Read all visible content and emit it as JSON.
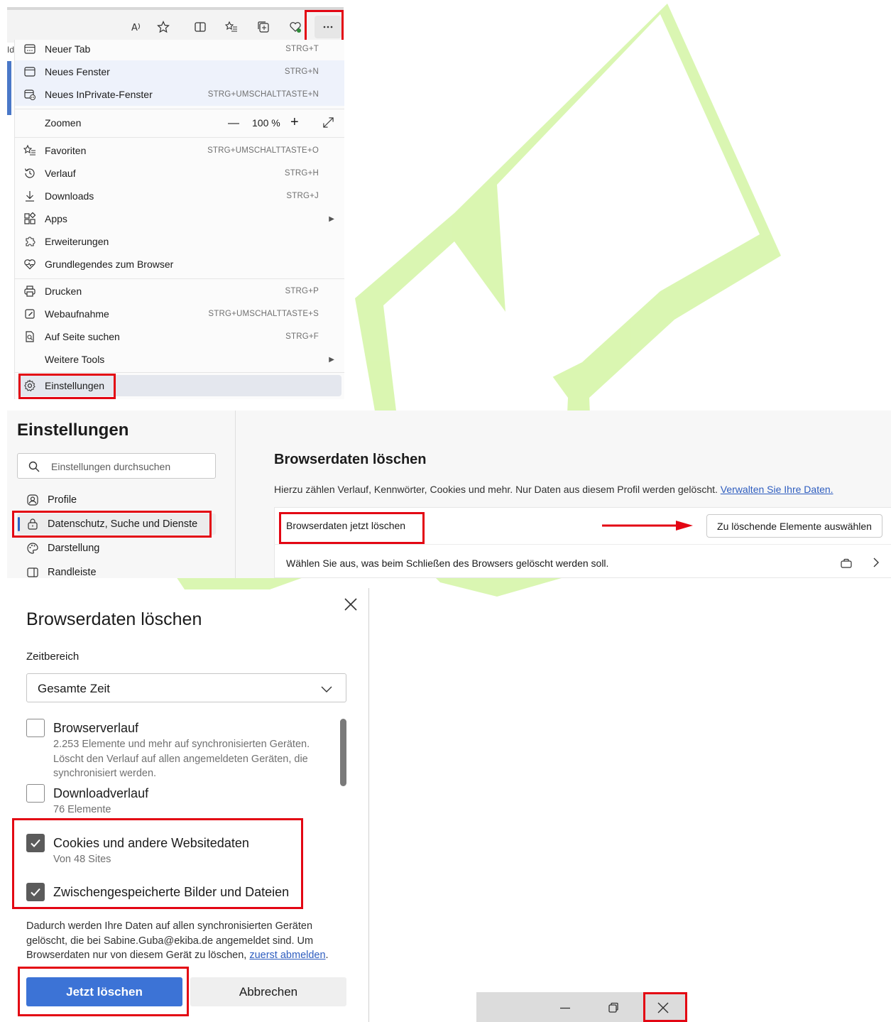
{
  "menu": {
    "zoom_value": "100 %",
    "items": [
      {
        "label": "Neuer Tab",
        "shortcut": "STRG+T",
        "icon": "new-tab-icon"
      },
      {
        "label": "Neues Fenster",
        "shortcut": "STRG+N",
        "icon": "window-icon"
      },
      {
        "label": "Neues InPrivate-Fenster",
        "shortcut": "STRG+UMSCHALTTASTE+N",
        "icon": "inprivate-icon"
      },
      {
        "label": "Zoomen",
        "shortcut": "",
        "icon": ""
      },
      {
        "label": "Favoriten",
        "shortcut": "STRG+UMSCHALTTASTE+O",
        "icon": "favorites-icon"
      },
      {
        "label": "Verlauf",
        "shortcut": "STRG+H",
        "icon": "history-icon"
      },
      {
        "label": "Downloads",
        "shortcut": "STRG+J",
        "icon": "download-icon"
      },
      {
        "label": "Apps",
        "shortcut": "",
        "icon": "apps-icon"
      },
      {
        "label": "Erweiterungen",
        "shortcut": "",
        "icon": "extensions-icon"
      },
      {
        "label": "Grundlegendes zum Browser",
        "shortcut": "",
        "icon": "heartbeat-icon"
      },
      {
        "label": "Drucken",
        "shortcut": "STRG+P",
        "icon": "printer-icon"
      },
      {
        "label": "Webaufnahme",
        "shortcut": "STRG+UMSCHALTTASTE+S",
        "icon": "web-capture-icon"
      },
      {
        "label": "Auf Seite suchen",
        "shortcut": "STRG+F",
        "icon": "find-on-page-icon"
      },
      {
        "label": "Weitere Tools",
        "shortcut": "",
        "icon": ""
      },
      {
        "label": "Einstellungen",
        "shortcut": "",
        "icon": "gear-icon"
      }
    ],
    "left_fragment": "Id"
  },
  "settings": {
    "title": "Einstellungen",
    "search_placeholder": "Einstellungen durchsuchen",
    "nav": [
      "Profile",
      "Datenschutz, Suche und Dienste",
      "Darstellung",
      "Randleiste"
    ],
    "content_title": "Browserdaten löschen",
    "content_desc": "Hierzu zählen Verlauf, Kennwörter, Cookies und mehr. Nur Daten aus diesem Profil werden gelöscht.",
    "content_link": "Verwalten Sie Ihre Daten.",
    "row1_label": "Browserdaten jetzt löschen",
    "row1_button": "Zu löschende Elemente auswählen",
    "row2_label": "Wählen Sie aus, was beim Schließen des Browsers gelöscht werden soll."
  },
  "dialog": {
    "title": "Browserdaten löschen",
    "range_label": "Zeitbereich",
    "range_value": "Gesamte Zeit",
    "options": [
      {
        "title": "Browserverlauf",
        "sub": "2.253 Elemente und mehr auf synchronisierten Geräten. Löscht den Verlauf auf allen angemeldeten Geräten, die synchronisiert werden.",
        "checked": false
      },
      {
        "title": "Downloadverlauf",
        "sub": "76 Elemente",
        "checked": false
      },
      {
        "title": "Cookies und andere Websitedaten",
        "sub": "Von 48 Sites",
        "checked": true
      },
      {
        "title": "Zwischengespeicherte Bilder und Dateien",
        "sub": "",
        "checked": true
      }
    ],
    "note": "Dadurch werden Ihre Daten auf allen synchronisierten Geräten gelöscht, die bei Sabine.Guba@ekiba.de angemeldet sind. Um Browserdaten nur von diesem Gerät zu löschen,",
    "note_link": "zuerst abmelden",
    "note_end": ".",
    "delete_button": "Jetzt löschen",
    "cancel_button": "Abbrechen"
  },
  "colors": {
    "highlight_box": "#e30613",
    "watermark": "#c8f08a",
    "primary_button": "#3c73d6",
    "link": "#2e5dbf"
  }
}
